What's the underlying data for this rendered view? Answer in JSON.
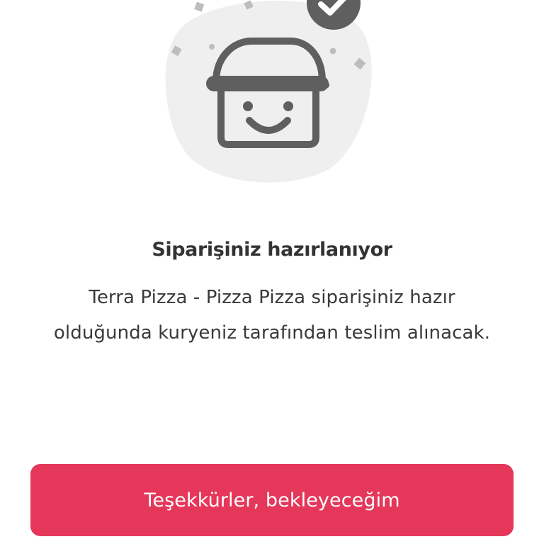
{
  "status": {
    "title": "Siparişiniz hazırlanıyor",
    "message": "Terra Pizza - Pizza Pizza siparişiniz hazır olduğunda kuryeniz tarafından teslim alınacak."
  },
  "actions": {
    "confirm_label": "Teşekkürler, bekleyeceğim"
  },
  "icons": {
    "illustration": "smiling-basket-icon",
    "badge": "check-badge-icon"
  },
  "colors": {
    "accent": "#e5375a",
    "icon_gray": "#5f5f5f",
    "blob": "#efefef",
    "text": "#333333"
  }
}
